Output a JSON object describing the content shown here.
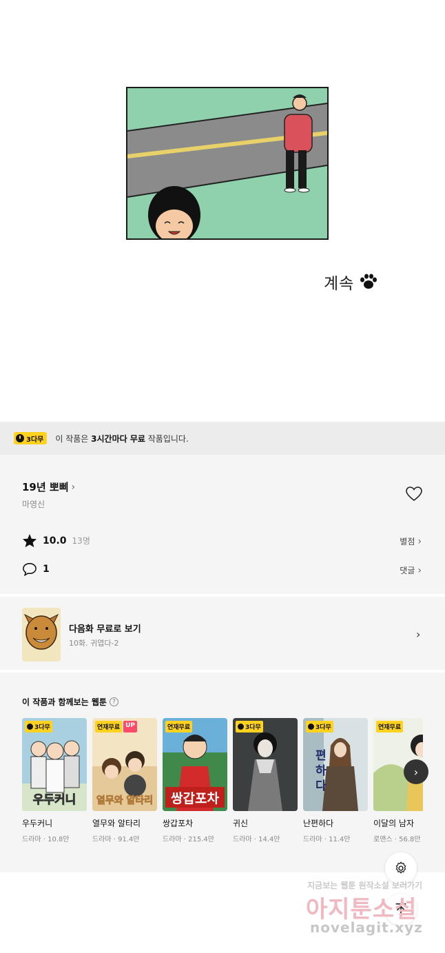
{
  "comic": {
    "continue_text": "계속"
  },
  "notice": {
    "badge": "3다무",
    "prefix": "이 작품은 ",
    "bold": "3시간마다 무료",
    "suffix": " 작품입니다."
  },
  "series": {
    "title": "19년 뽀삐",
    "author": "마영신",
    "rating": "10.0",
    "rating_count": "13명",
    "rating_link": "별점",
    "comments": "1",
    "comment_link": "댓글"
  },
  "next_episode": {
    "title": "다음화 무료로 보기",
    "subtitle": "10화. 귀엽다-2"
  },
  "recommend": {
    "heading": "이 작품과 함께보는 웹툰",
    "items": [
      {
        "name": "우두커니",
        "meta": "드라마 · 10.8만",
        "badge": "3다무",
        "up": ""
      },
      {
        "name": "열무와 알타리",
        "meta": "드라마 · 91.4만",
        "badge": "연재무료",
        "up": "UP"
      },
      {
        "name": "쌍갑포차",
        "meta": "드라마 · 215.4만",
        "badge": "연재무료",
        "up": ""
      },
      {
        "name": "귀신",
        "meta": "드라마 · 14.4만",
        "badge": "3다무",
        "up": ""
      },
      {
        "name": "난편하다",
        "meta": "드라마 · 11.4만",
        "badge": "3다무",
        "up": ""
      },
      {
        "name": "이달의 남자",
        "meta": "로맨스 · 56.8만",
        "badge": "연재무료",
        "up": ""
      }
    ]
  },
  "watermark": {
    "line1": "지금보는 웹툰 원작소설 보러가기",
    "line2": "아지툰소설",
    "line3": "novelagit.xyz"
  },
  "colors": {
    "accent_yellow": "#ffd21f",
    "up_pink": "#ff4a6a",
    "panel_green": "#8fd0ad"
  }
}
